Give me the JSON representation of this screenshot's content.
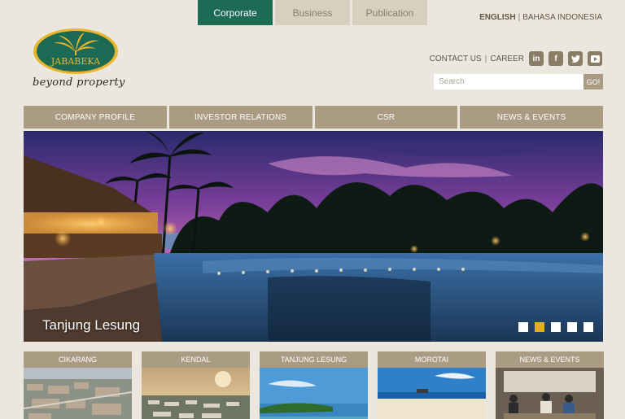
{
  "top_tabs": [
    {
      "label": "Corporate",
      "active": true
    },
    {
      "label": "Business",
      "active": false
    },
    {
      "label": "Publication",
      "active": false
    }
  ],
  "language": {
    "english": "ENGLISH",
    "bahasa": "BAHASA INDONESIA"
  },
  "brand": {
    "logo_text": "JABABEKA",
    "tagline": "beyond property",
    "accent": "#1e6b55",
    "gold": "#e3ac2a"
  },
  "utility": {
    "contact": "CONTACT US",
    "career": "CAREER"
  },
  "social": [
    {
      "icon": "linkedin-icon",
      "glyph": "in"
    },
    {
      "icon": "facebook-icon",
      "glyph": "f"
    },
    {
      "icon": "twitter-icon",
      "glyph": "t"
    },
    {
      "icon": "youtube-icon",
      "glyph": "▶"
    }
  ],
  "search": {
    "placeholder": "Search",
    "button": "GO!"
  },
  "nav": [
    "COMPANY PROFILE",
    "INVESTOR RELATIONS",
    "CSR",
    "NEWS & EVENTS"
  ],
  "hero": {
    "caption": "Tanjung Lesung",
    "slide_count": 5,
    "active_slide": 1
  },
  "cards": [
    "CIKARANG",
    "KENDAL",
    "TANJUNG LESUNG",
    "MOROTAI",
    "NEWS & EVENTS"
  ]
}
